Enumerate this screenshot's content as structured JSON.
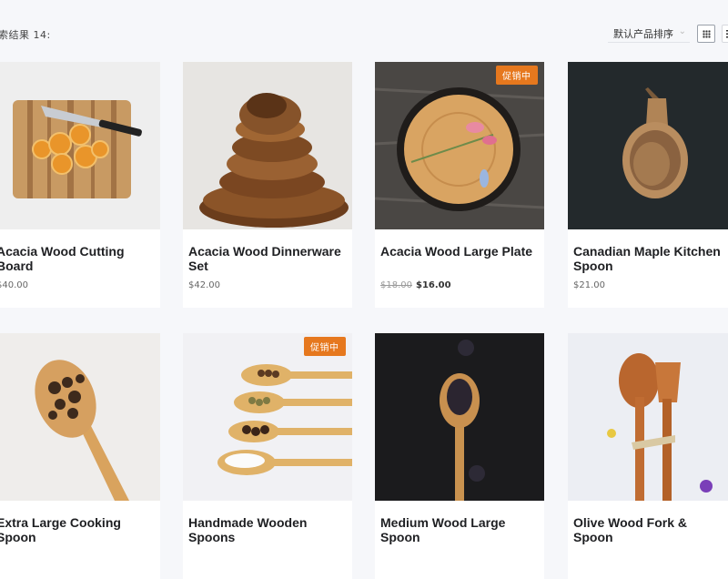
{
  "toolbar": {
    "result_count": "索结果 14:",
    "sort_label": "默认产品排序",
    "sort_chevron": "⌄"
  },
  "products": [
    {
      "name": "Acacia Wood Cutting Board",
      "price": "$40.00"
    },
    {
      "name": "Acacia Wood Dinnerware Set",
      "price": "$42.00"
    },
    {
      "name": "Acacia Wood Large Plate",
      "old_price": "$18.00",
      "price": "$16.00",
      "badge": "促销中"
    },
    {
      "name": "Canadian Maple Kitchen Spoon",
      "price": "$21.00"
    },
    {
      "name": "Extra Large Cooking Spoon"
    },
    {
      "name": "Handmade Wooden Spoons",
      "badge": "促销中"
    },
    {
      "name": "Medium Wood Large Spoon"
    },
    {
      "name": "Olive Wood Fork & Spoon"
    }
  ],
  "colors": {
    "accent": "#e6781e",
    "background": "#f6f7fa"
  },
  "icons": {
    "grid_view": "grid-icon",
    "list_view": "list-icon"
  }
}
